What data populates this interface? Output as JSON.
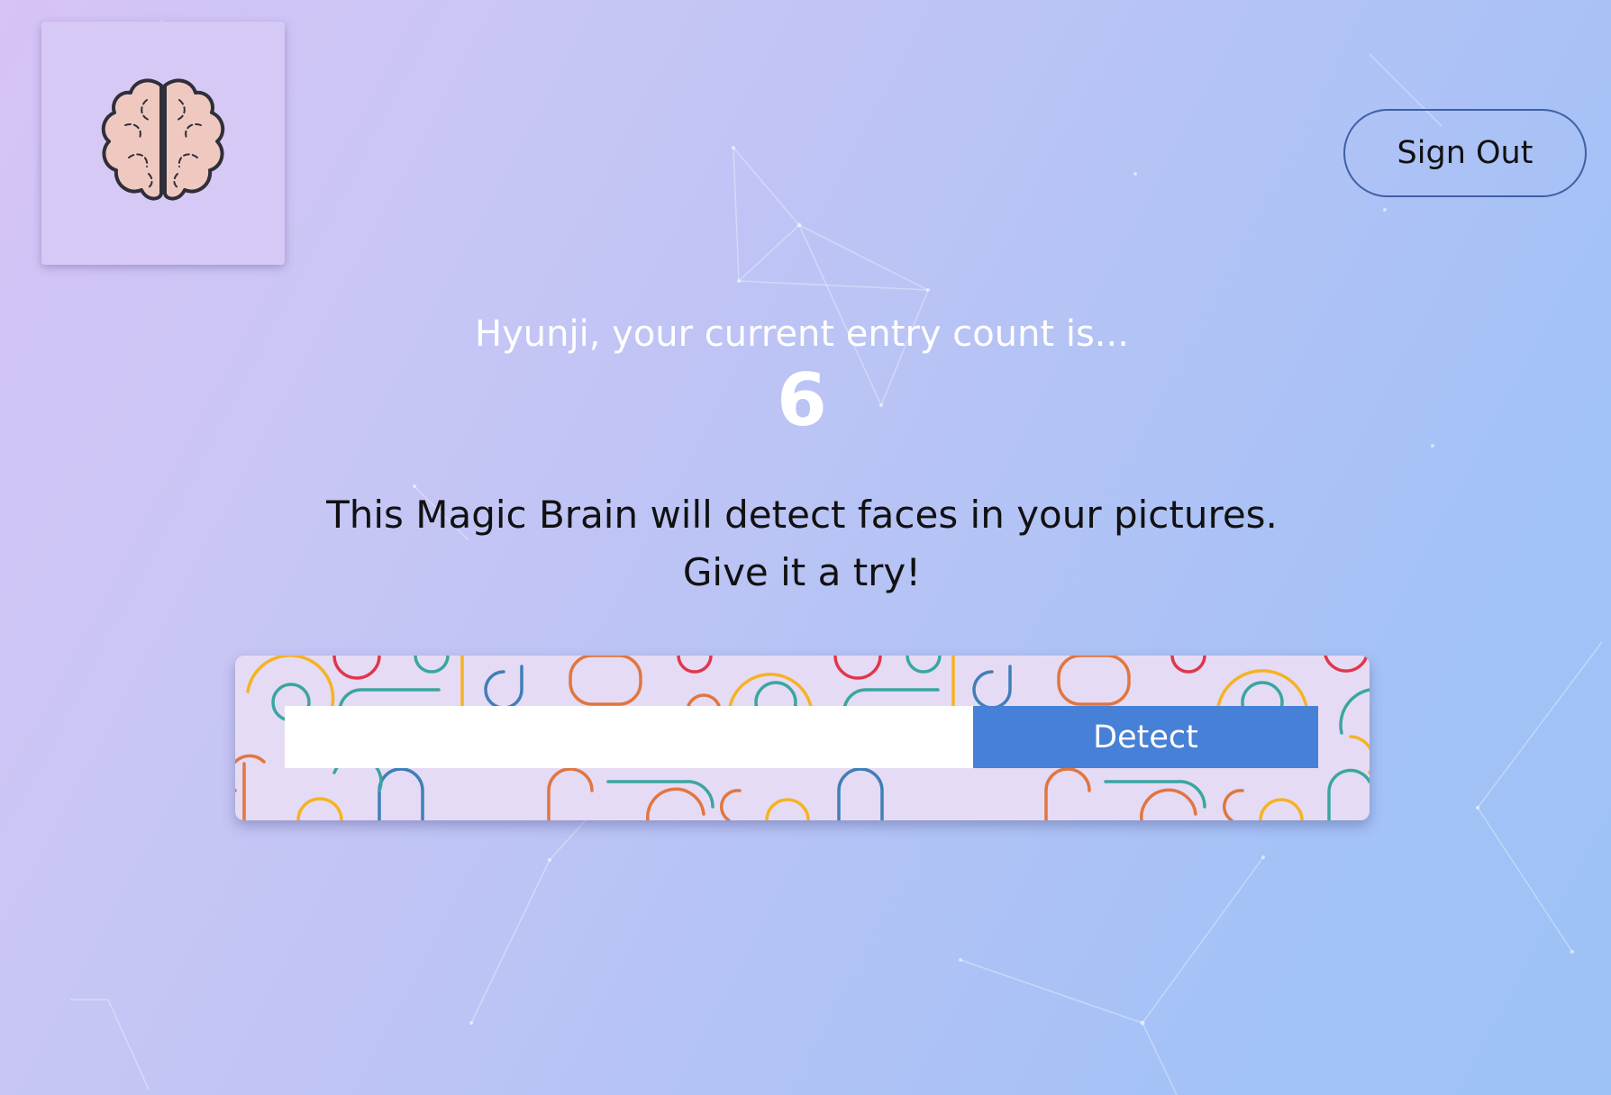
{
  "header": {
    "logo_icon": "brain-icon",
    "signout_label": "Sign Out"
  },
  "rank": {
    "greeting": "Hyunji, your current entry count is...",
    "count": "6"
  },
  "intro": {
    "line1": "This Magic Brain will detect faces in your pictures.",
    "line2": "Give it a try!"
  },
  "image_form": {
    "url_value": "",
    "url_placeholder": "",
    "detect_label": "Detect"
  },
  "colors": {
    "detect_button": "#4780d7",
    "signout_border": "#3f5fa6",
    "brain_fill": "#efc9c0"
  }
}
